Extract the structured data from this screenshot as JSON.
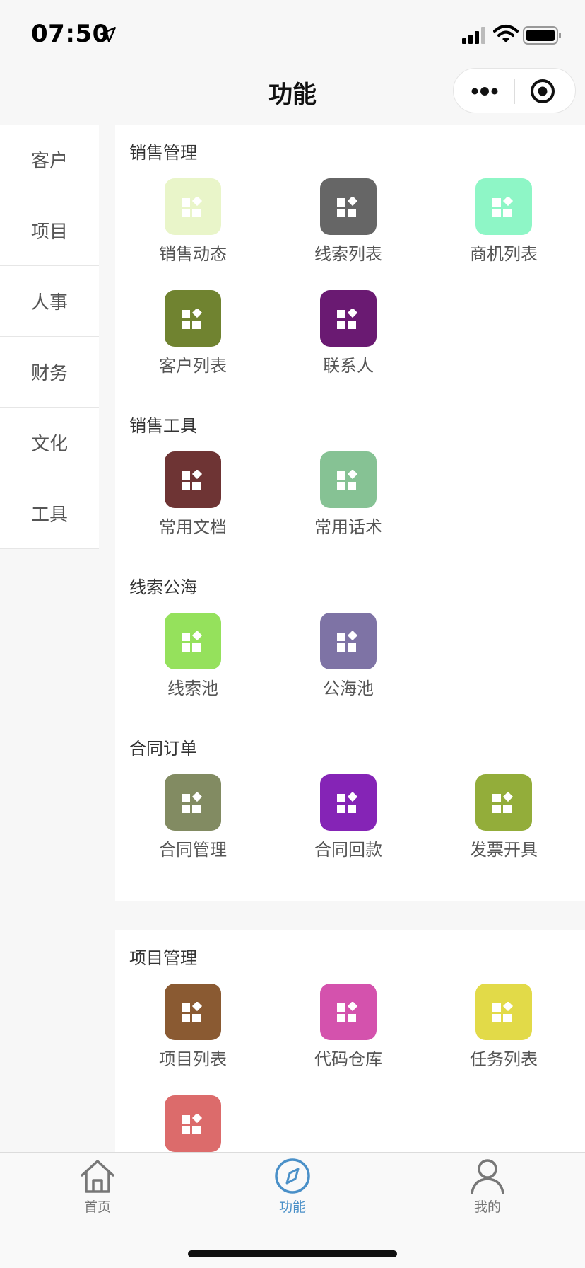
{
  "status": {
    "time": "07:50"
  },
  "header": {
    "title": "功能"
  },
  "sidebar": {
    "items": [
      {
        "label": "客户"
      },
      {
        "label": "项目"
      },
      {
        "label": "人事"
      },
      {
        "label": "财务"
      },
      {
        "label": "文化"
      },
      {
        "label": "工具"
      }
    ]
  },
  "sections": [
    {
      "title": "销售管理",
      "items": [
        {
          "label": "销售动态",
          "color": "#e9f5c9"
        },
        {
          "label": "线索列表",
          "color": "#666666"
        },
        {
          "label": "商机列表",
          "color": "#8ef6c6"
        },
        {
          "label": "客户列表",
          "color": "#708330"
        },
        {
          "label": "联系人",
          "color": "#6a1a72"
        }
      ]
    },
    {
      "title": "销售工具",
      "items": [
        {
          "label": "常用文档",
          "color": "#6e3434"
        },
        {
          "label": "常用话术",
          "color": "#86c294"
        }
      ]
    },
    {
      "title": "线索公海",
      "items": [
        {
          "label": "线索池",
          "color": "#95e15c"
        },
        {
          "label": "公海池",
          "color": "#7e73a5"
        }
      ]
    },
    {
      "title": "合同订单",
      "items": [
        {
          "label": "合同管理",
          "color": "#828b62"
        },
        {
          "label": "合同回款",
          "color": "#8524b6"
        },
        {
          "label": "发票开具",
          "color": "#93ad3a"
        }
      ]
    },
    {
      "title": "项目管理",
      "items": [
        {
          "label": "项目列表",
          "color": "#8a5a32"
        },
        {
          "label": "代码仓库",
          "color": "#d452ad"
        },
        {
          "label": "任务列表",
          "color": "#e2da48"
        },
        {
          "label": "",
          "color": "#dc6b6b"
        }
      ]
    }
  ],
  "tabbar": {
    "items": [
      {
        "label": "首页",
        "icon": "home-icon"
      },
      {
        "label": "功能",
        "icon": "compass-icon",
        "active": true
      },
      {
        "label": "我的",
        "icon": "user-icon"
      }
    ],
    "active_color": "#4a90c8"
  }
}
